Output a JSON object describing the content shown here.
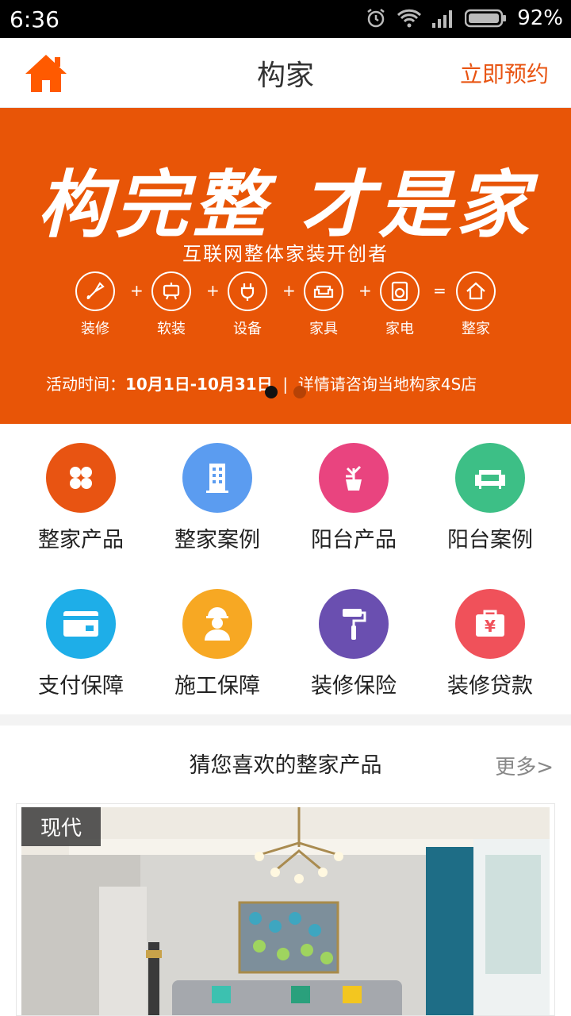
{
  "status_bar": {
    "time": "6:36",
    "battery": "92%"
  },
  "header": {
    "title": "构家",
    "book_label": "立即预约"
  },
  "banner": {
    "headline": "构完整 才是家",
    "subtitle": "互联网整体家装开创者",
    "formula": [
      {
        "icon": "brush-icon",
        "label": "装修"
      },
      {
        "icon": "lamp-icon",
        "label": "软装"
      },
      {
        "icon": "plug-icon",
        "label": "设备"
      },
      {
        "icon": "sofa-icon",
        "label": "家具"
      },
      {
        "icon": "washer-icon",
        "label": "家电"
      },
      {
        "icon": "house-icon",
        "label": "整家"
      }
    ],
    "activity_label": "活动时间：",
    "activity_dates": "10月1日-10月31日",
    "activity_note": "详情请咨询当地构家4S店"
  },
  "grid": [
    {
      "label": "整家产品",
      "icon": "clover-icon",
      "color": "#e85412"
    },
    {
      "label": "整家案例",
      "icon": "building-icon",
      "color": "#5b9cf0"
    },
    {
      "label": "阳台产品",
      "icon": "plant-icon",
      "color": "#e9447f"
    },
    {
      "label": "阳台案例",
      "icon": "sofa-icon",
      "color": "#3dbf86"
    },
    {
      "label": "支付保障",
      "icon": "card-icon",
      "color": "#1eaee8"
    },
    {
      "label": "施工保障",
      "icon": "worker-icon",
      "color": "#f7a823"
    },
    {
      "label": "装修保险",
      "icon": "paint-roller-icon",
      "color": "#6a4fb0"
    },
    {
      "label": "装修贷款",
      "icon": "money-bag-icon",
      "color": "#f0515a"
    }
  ],
  "recommend": {
    "title": "猜您喜欢的整家产品",
    "more": "更多>"
  },
  "product": {
    "tag": "现代"
  }
}
